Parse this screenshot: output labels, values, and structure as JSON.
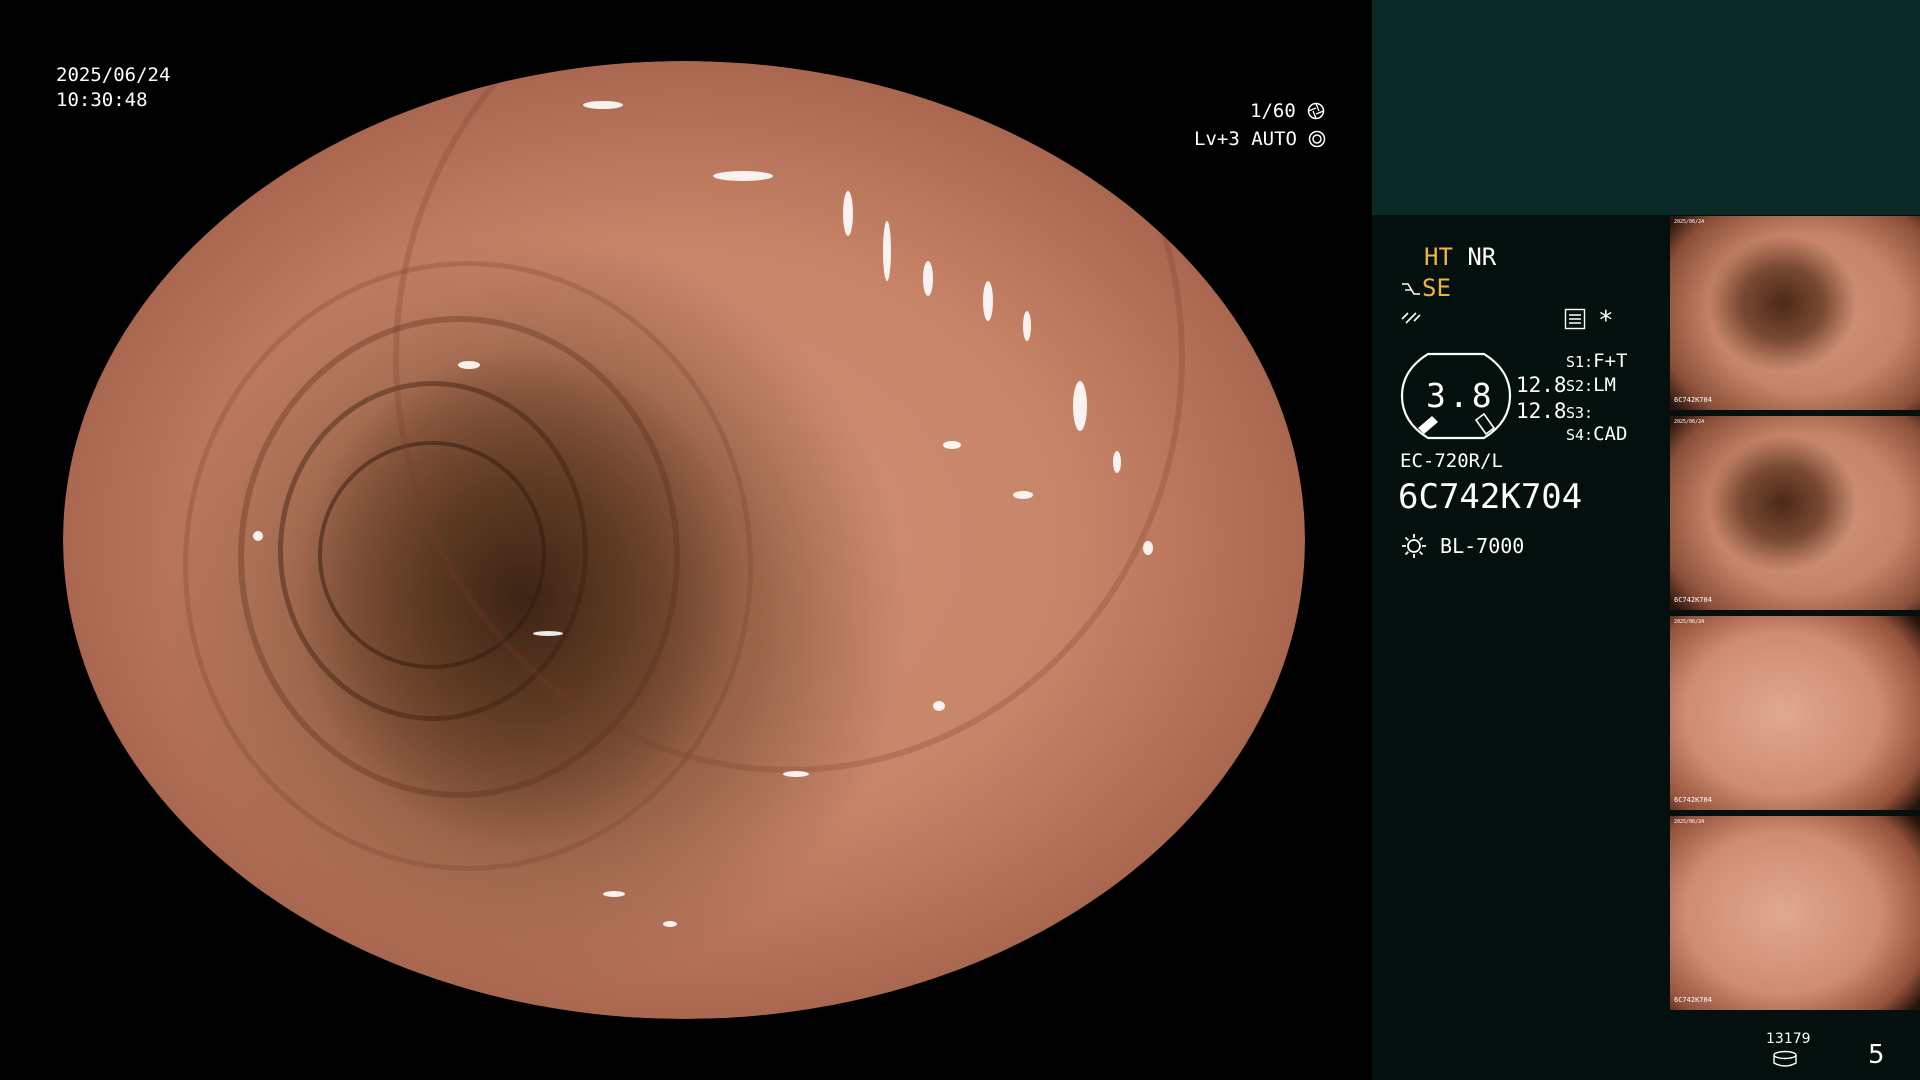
{
  "main": {
    "date": "2025/06/24",
    "time": "10:30:48",
    "shutter": "1/60",
    "exposure_level": "Lv+3",
    "exposure_mode": "AUTO",
    "shutter_icon": "aperture-icon",
    "auto_icon": "auto-iris-icon"
  },
  "sidebar": {
    "ht": "HT",
    "nr": "NR",
    "se": "SE",
    "se_icon": "edge-enhance-icon",
    "color_icon": "color-mode-icon",
    "menu_icon": "menu-icon",
    "star": "*",
    "gauge_value": "3.8",
    "value_top": "12.8",
    "value_bottom": "12.8",
    "switches": [
      {
        "key": "S1:",
        "value": "F+T"
      },
      {
        "key": "S2:",
        "value": "LM"
      },
      {
        "key": "S3:",
        "value": ""
      },
      {
        "key": "S4:",
        "value": "CAD"
      }
    ],
    "scope_model": "EC-720R/L",
    "scope_serial": "6C742K704",
    "light_icon": "light-source-icon",
    "light_source": "BL-7000",
    "storage_count": "13179",
    "storage_icon": "disk-icon",
    "capture_count": "5"
  },
  "thumbnails": [
    {
      "label": "6C742K704",
      "stamp": "2025/06/24"
    },
    {
      "label": "6C742K704",
      "stamp": "2025/06/24"
    },
    {
      "label": "6C742K704",
      "stamp": "2025/06/24"
    },
    {
      "label": "6C742K704",
      "stamp": "2025/06/24"
    }
  ],
  "colors": {
    "accent_yellow": "#f2b33d",
    "sidebar_bg": "#03100d",
    "sidebar_top_bg": "#0b2a25"
  }
}
